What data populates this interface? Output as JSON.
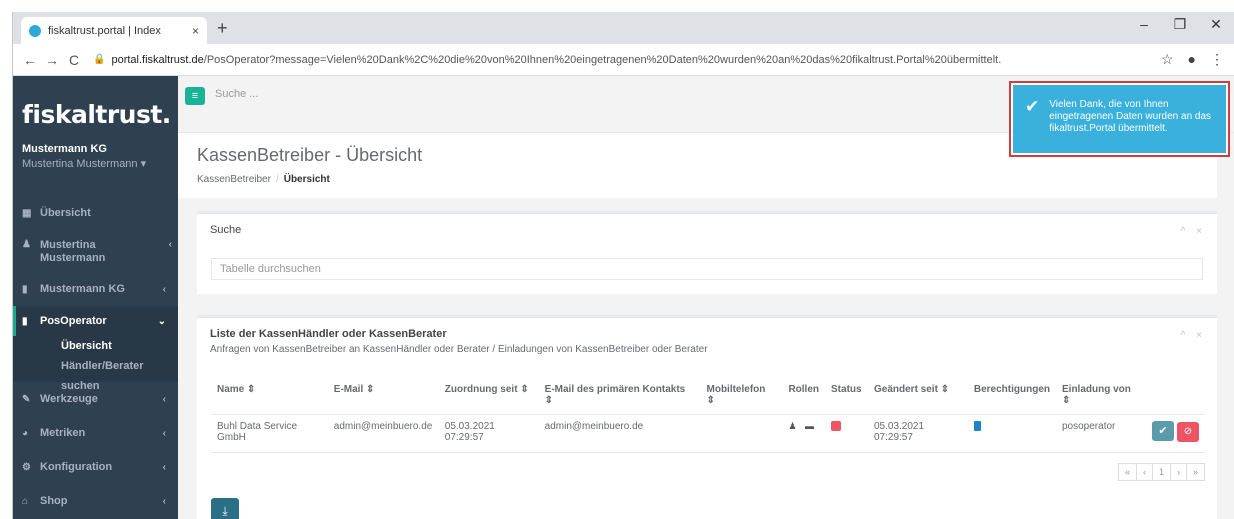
{
  "browser": {
    "tab_title": "fiskaltrust.portal | Index",
    "tab_close": "×",
    "new_tab": "+",
    "url_host": "portal.fiskaltrust.de",
    "url_path": "/PosOperator?message=Vielen%20Dank%2C%20die%20von%20Ihnen%20eingetragenen%20Daten%20wurden%20an%20das%20fikaltrust.Portal%20übermittelt.",
    "back": "←",
    "forward": "→",
    "reload": "C",
    "lock": "🔒",
    "star": "☆",
    "profile": "●",
    "menu": "⋮",
    "minimize": "–",
    "restore": "❐",
    "close": "✕"
  },
  "sidebar": {
    "logo": "fiskaltrust.",
    "org": "Mustermann KG",
    "user": "Mustertina Mustermann ▾",
    "items": [
      {
        "label": "Übersicht",
        "icon": "▦"
      },
      {
        "label": "Mustertina Mustermann",
        "icon": "♟"
      },
      {
        "label": "Mustermann KG",
        "icon": "▮"
      },
      {
        "label": "PosOperator",
        "icon": "▮"
      },
      {
        "label": "Werkzeuge",
        "icon": "✎"
      },
      {
        "label": "Metriken",
        "icon": "◕"
      },
      {
        "label": "Konfiguration",
        "icon": "⚙"
      },
      {
        "label": "Shop",
        "icon": "⌂"
      }
    ],
    "subitems": [
      "Übersicht",
      "Händler/Berater suchen"
    ],
    "chevron_left": "‹",
    "chevron_down": "⌄"
  },
  "topbar": {
    "menu_icon": "≡",
    "search_placeholder": "Suche ..."
  },
  "header": {
    "title": "KassenBetreiber - Übersicht",
    "crumb_1": "KassenBetreiber",
    "crumb_sep": "/",
    "crumb_2": "Übersicht"
  },
  "search_box": {
    "title": "Suche",
    "placeholder": "Tabelle durchsuchen",
    "tools": "^ ×"
  },
  "list_box": {
    "title": "Liste der KassenHändler oder KassenBerater",
    "subtitle": "Anfragen von KassenBetreiber an KassenHändler oder Berater / Einladungen von KassenBetreiber oder Berater",
    "tools": "^ ×",
    "columns": [
      "Name ⇕",
      "E-Mail ⇕",
      "Zuordnung seit ⇕",
      "E-Mail des primären Kontakts ⇕",
      "Mobiltelefon ⇕",
      "Rollen",
      "Status",
      "Geändert seit ⇕",
      "Berechtigungen",
      "Einladung von ⇕",
      ""
    ],
    "rows": [
      {
        "name": "Buhl Data Service GmbH",
        "email": "admin@meinbuero.de",
        "since": "05.03.2021 07:29:57",
        "contact": "admin@meinbuero.de",
        "mobile": "",
        "roles": "♟ ▬",
        "changed": "05.03.2021 07:29:57",
        "invited_by": "posoperator",
        "accept": "✔",
        "reject": "⊘"
      }
    ],
    "pager": [
      "«",
      "‹",
      "1",
      "›",
      "»"
    ],
    "download": "⤓"
  },
  "toast": {
    "icon": "✔",
    "message": "Vielen Dank, die von Ihnen eingetragenen Daten wurden an das fikaltrust.Portal übermittelt."
  },
  "colors": {
    "sidebar_bg": "#2f4050",
    "accent_green": "#1ab394",
    "toast_bg": "#3ab0dc",
    "danger": "#ed5565",
    "download_btn": "#2a6f86"
  }
}
